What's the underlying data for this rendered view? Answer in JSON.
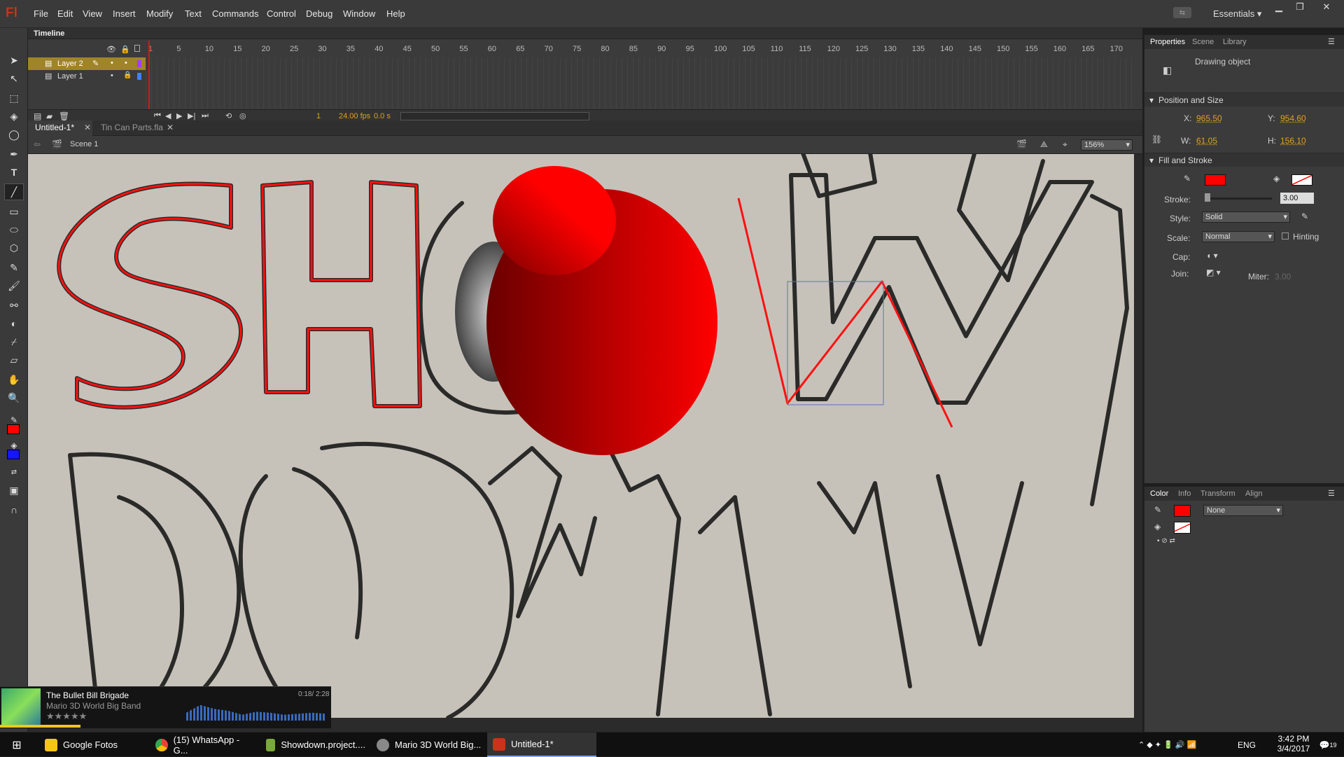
{
  "app": {
    "logo": "Fl",
    "workspace": "Essentials ▾"
  },
  "menu": [
    "File",
    "Edit",
    "View",
    "Insert",
    "Modify",
    "Text",
    "Commands",
    "Control",
    "Debug",
    "Window",
    "Help"
  ],
  "timeline": {
    "title": "Timeline",
    "frame_numbers": [
      "1",
      "5",
      "10",
      "15",
      "20",
      "25",
      "30",
      "35",
      "40",
      "45",
      "50",
      "55",
      "60",
      "65",
      "70",
      "75",
      "80",
      "85",
      "90",
      "95",
      "100",
      "105",
      "110",
      "115",
      "120",
      "125",
      "130",
      "135",
      "140",
      "145",
      "150",
      "155",
      "160",
      "165",
      "170",
      "17"
    ],
    "layers": [
      {
        "name": "Layer 2",
        "active": true
      },
      {
        "name": "Layer 1",
        "active": false
      }
    ],
    "current_frame": "1",
    "fps": "24.00 fps",
    "time": "0.0 s"
  },
  "doc_tabs": [
    "Untitled-1*",
    "Tin Can Parts.fla"
  ],
  "scene": "Scene 1",
  "zoom": "156%",
  "properties": {
    "tabs": [
      "Properties",
      "Scene",
      "Library"
    ],
    "object_type": "Drawing object",
    "section_position": "Position and Size",
    "x_label": "X:",
    "x": "965.50",
    "y_label": "Y:",
    "y": "954.60",
    "w_label": "W:",
    "w": "61.05",
    "h_label": "H:",
    "h": "156.10",
    "section_fill": "Fill and Stroke",
    "stroke_label": "Stroke:",
    "stroke_value": "3.00",
    "style_label": "Style:",
    "style_value": "Solid",
    "scale_label": "Scale:",
    "scale_value": "Normal",
    "hinting": "Hinting",
    "cap_label": "Cap:",
    "join_label": "Join:",
    "miter_label": "Miter:",
    "miter_value": "3.00",
    "stroke_color": "#ff0000"
  },
  "color_panel": {
    "tabs": [
      "Color",
      "Info",
      "Transform",
      "Align"
    ],
    "type": "None"
  },
  "player": {
    "track": "The Bullet Bill Brigade",
    "artist": "Mario 3D World Big Band",
    "time": "0:18/ 2:28",
    "stars": "★★★★★"
  },
  "taskbar": {
    "apps": [
      {
        "label": "Google Fotos",
        "color": "#f5c518"
      },
      {
        "label": "(15) WhatsApp - G...",
        "color": "#34a853"
      },
      {
        "label": "Showdown.project....",
        "color": "#7aa83a"
      },
      {
        "label": "Mario 3D World Big...",
        "color": "#888"
      },
      {
        "label": "Untitled-1*",
        "color": "#c8331a"
      }
    ],
    "lang": "ENG",
    "time": "3:42 PM",
    "date": "3/4/2017",
    "notif": "19"
  }
}
